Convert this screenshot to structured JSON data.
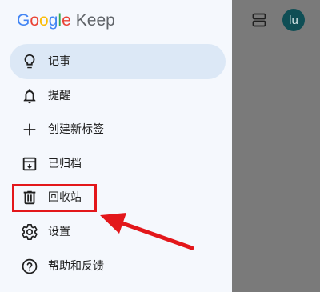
{
  "app": {
    "logo_letters": [
      {
        "char": "G",
        "color": "#4285F4"
      },
      {
        "char": "o",
        "color": "#EA4335"
      },
      {
        "char": "o",
        "color": "#FBBC05"
      },
      {
        "char": "g",
        "color": "#4285F4"
      },
      {
        "char": "l",
        "color": "#34A853"
      },
      {
        "char": "e",
        "color": "#EA4335"
      }
    ],
    "logo_suffix": "Keep"
  },
  "header": {
    "avatar_text": "lu",
    "layout_icon": "view-agenda-icon"
  },
  "drawer": {
    "items": [
      {
        "label": "记事",
        "icon": "lightbulb-icon",
        "active": true
      },
      {
        "label": "提醒",
        "icon": "bell-icon",
        "active": false
      },
      {
        "label": "创建新标签",
        "icon": "plus-icon",
        "active": false
      },
      {
        "label": "已归档",
        "icon": "archive-icon",
        "active": false
      },
      {
        "label": "回收站",
        "icon": "trash-icon",
        "active": false
      },
      {
        "label": "设置",
        "icon": "gear-icon",
        "active": false
      },
      {
        "label": "帮助和反馈",
        "icon": "help-circle-icon",
        "active": false
      }
    ]
  },
  "colors": {
    "drawer_bg": "#f5f8fd",
    "active_bg": "#dce8f6",
    "scrim": "#7a7a7a",
    "avatar_bg": "#0f4e55",
    "annotation_red": "#e3171b"
  },
  "annotation": {
    "highlighted_item": "回收站",
    "arrow_direction": "pointing left toward highlighted item"
  }
}
